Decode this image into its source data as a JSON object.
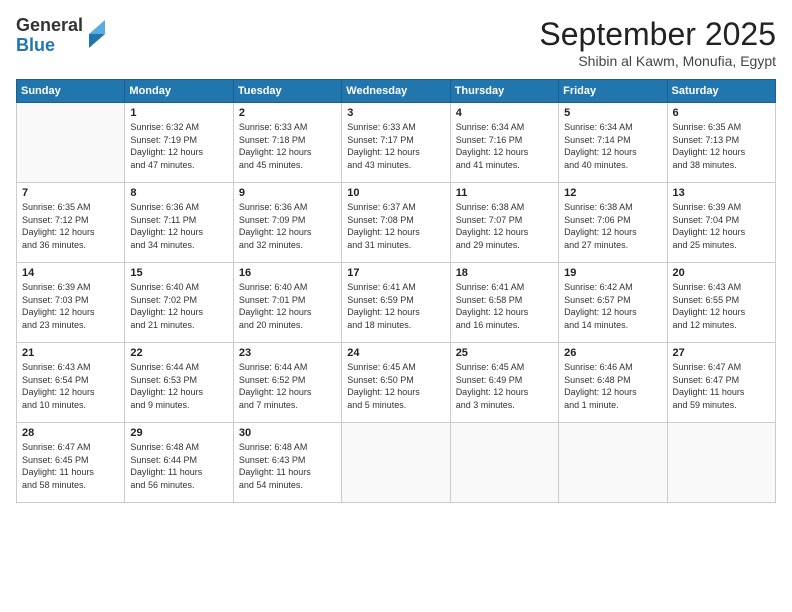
{
  "logo": {
    "general": "General",
    "blue": "Blue"
  },
  "header": {
    "month": "September 2025",
    "location": "Shibin al Kawm, Monufia, Egypt"
  },
  "weekdays": [
    "Sunday",
    "Monday",
    "Tuesday",
    "Wednesday",
    "Thursday",
    "Friday",
    "Saturday"
  ],
  "weeks": [
    [
      {
        "day": "",
        "info": ""
      },
      {
        "day": "1",
        "info": "Sunrise: 6:32 AM\nSunset: 7:19 PM\nDaylight: 12 hours\nand 47 minutes."
      },
      {
        "day": "2",
        "info": "Sunrise: 6:33 AM\nSunset: 7:18 PM\nDaylight: 12 hours\nand 45 minutes."
      },
      {
        "day": "3",
        "info": "Sunrise: 6:33 AM\nSunset: 7:17 PM\nDaylight: 12 hours\nand 43 minutes."
      },
      {
        "day": "4",
        "info": "Sunrise: 6:34 AM\nSunset: 7:16 PM\nDaylight: 12 hours\nand 41 minutes."
      },
      {
        "day": "5",
        "info": "Sunrise: 6:34 AM\nSunset: 7:14 PM\nDaylight: 12 hours\nand 40 minutes."
      },
      {
        "day": "6",
        "info": "Sunrise: 6:35 AM\nSunset: 7:13 PM\nDaylight: 12 hours\nand 38 minutes."
      }
    ],
    [
      {
        "day": "7",
        "info": "Sunrise: 6:35 AM\nSunset: 7:12 PM\nDaylight: 12 hours\nand 36 minutes."
      },
      {
        "day": "8",
        "info": "Sunrise: 6:36 AM\nSunset: 7:11 PM\nDaylight: 12 hours\nand 34 minutes."
      },
      {
        "day": "9",
        "info": "Sunrise: 6:36 AM\nSunset: 7:09 PM\nDaylight: 12 hours\nand 32 minutes."
      },
      {
        "day": "10",
        "info": "Sunrise: 6:37 AM\nSunset: 7:08 PM\nDaylight: 12 hours\nand 31 minutes."
      },
      {
        "day": "11",
        "info": "Sunrise: 6:38 AM\nSunset: 7:07 PM\nDaylight: 12 hours\nand 29 minutes."
      },
      {
        "day": "12",
        "info": "Sunrise: 6:38 AM\nSunset: 7:06 PM\nDaylight: 12 hours\nand 27 minutes."
      },
      {
        "day": "13",
        "info": "Sunrise: 6:39 AM\nSunset: 7:04 PM\nDaylight: 12 hours\nand 25 minutes."
      }
    ],
    [
      {
        "day": "14",
        "info": "Sunrise: 6:39 AM\nSunset: 7:03 PM\nDaylight: 12 hours\nand 23 minutes."
      },
      {
        "day": "15",
        "info": "Sunrise: 6:40 AM\nSunset: 7:02 PM\nDaylight: 12 hours\nand 21 minutes."
      },
      {
        "day": "16",
        "info": "Sunrise: 6:40 AM\nSunset: 7:01 PM\nDaylight: 12 hours\nand 20 minutes."
      },
      {
        "day": "17",
        "info": "Sunrise: 6:41 AM\nSunset: 6:59 PM\nDaylight: 12 hours\nand 18 minutes."
      },
      {
        "day": "18",
        "info": "Sunrise: 6:41 AM\nSunset: 6:58 PM\nDaylight: 12 hours\nand 16 minutes."
      },
      {
        "day": "19",
        "info": "Sunrise: 6:42 AM\nSunset: 6:57 PM\nDaylight: 12 hours\nand 14 minutes."
      },
      {
        "day": "20",
        "info": "Sunrise: 6:43 AM\nSunset: 6:55 PM\nDaylight: 12 hours\nand 12 minutes."
      }
    ],
    [
      {
        "day": "21",
        "info": "Sunrise: 6:43 AM\nSunset: 6:54 PM\nDaylight: 12 hours\nand 10 minutes."
      },
      {
        "day": "22",
        "info": "Sunrise: 6:44 AM\nSunset: 6:53 PM\nDaylight: 12 hours\nand 9 minutes."
      },
      {
        "day": "23",
        "info": "Sunrise: 6:44 AM\nSunset: 6:52 PM\nDaylight: 12 hours\nand 7 minutes."
      },
      {
        "day": "24",
        "info": "Sunrise: 6:45 AM\nSunset: 6:50 PM\nDaylight: 12 hours\nand 5 minutes."
      },
      {
        "day": "25",
        "info": "Sunrise: 6:45 AM\nSunset: 6:49 PM\nDaylight: 12 hours\nand 3 minutes."
      },
      {
        "day": "26",
        "info": "Sunrise: 6:46 AM\nSunset: 6:48 PM\nDaylight: 12 hours\nand 1 minute."
      },
      {
        "day": "27",
        "info": "Sunrise: 6:47 AM\nSunset: 6:47 PM\nDaylight: 11 hours\nand 59 minutes."
      }
    ],
    [
      {
        "day": "28",
        "info": "Sunrise: 6:47 AM\nSunset: 6:45 PM\nDaylight: 11 hours\nand 58 minutes."
      },
      {
        "day": "29",
        "info": "Sunrise: 6:48 AM\nSunset: 6:44 PM\nDaylight: 11 hours\nand 56 minutes."
      },
      {
        "day": "30",
        "info": "Sunrise: 6:48 AM\nSunset: 6:43 PM\nDaylight: 11 hours\nand 54 minutes."
      },
      {
        "day": "",
        "info": ""
      },
      {
        "day": "",
        "info": ""
      },
      {
        "day": "",
        "info": ""
      },
      {
        "day": "",
        "info": ""
      }
    ]
  ]
}
